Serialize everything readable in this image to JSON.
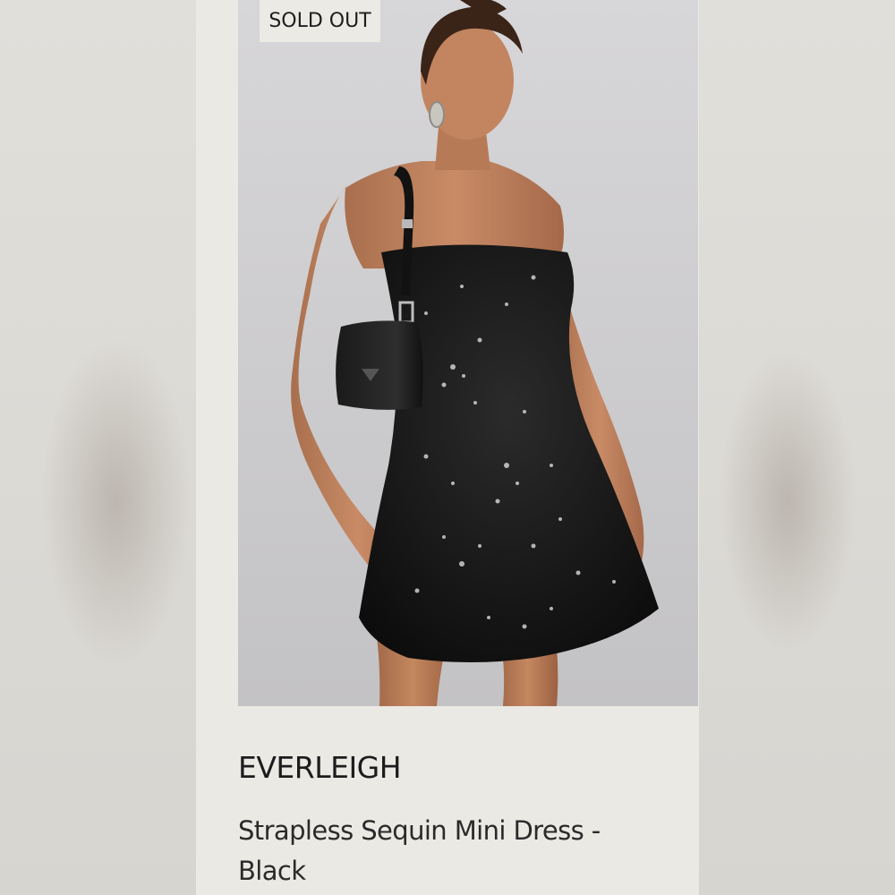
{
  "badge": {
    "label": "SOLD OUT"
  },
  "product": {
    "brand": "EVERLEIGH",
    "name": "Strapless Sequin Mini Dress - Black",
    "image_alt": "Model wearing black strapless sequin mini dress with black shoulder bag"
  },
  "colors": {
    "card_background": "#eae9e4",
    "photo_background": "#d2d1d3",
    "badge_background": "#ebeae5",
    "text": "#1c1c1c"
  }
}
